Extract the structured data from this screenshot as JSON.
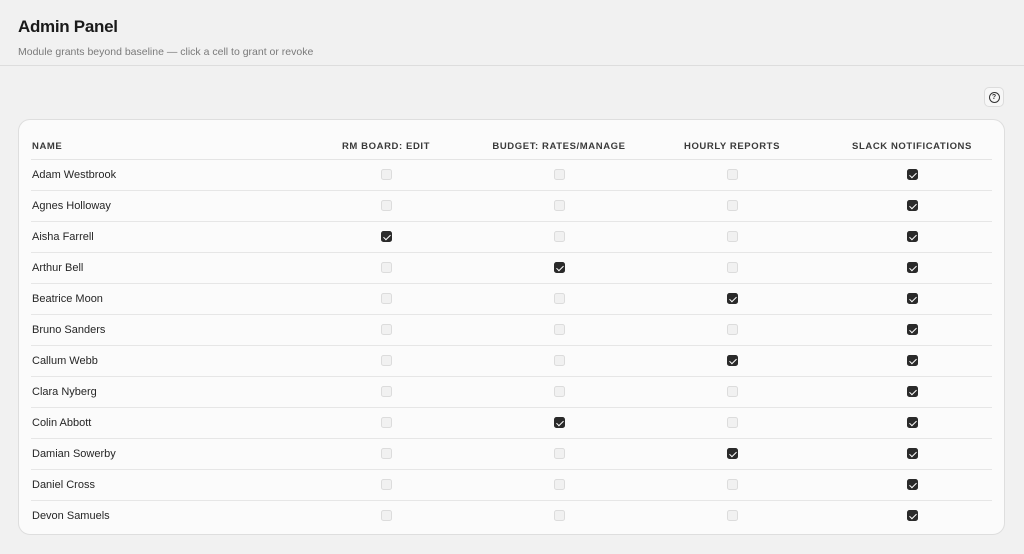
{
  "header": {
    "title": "Admin Panel",
    "subtitle": "Module grants beyond baseline — click a cell to grant or revoke"
  },
  "help": {
    "icon": "help-circle-icon",
    "glyph": "?"
  },
  "table": {
    "columns": [
      "NAME",
      "RM BOARD: EDIT",
      "BUDGET: RATES/MANAGE",
      "HOURLY REPORTS",
      "SLACK NOTIFICATIONS"
    ],
    "rows": [
      {
        "name": "Adam Westbrook",
        "grants": [
          false,
          false,
          false,
          true
        ]
      },
      {
        "name": "Agnes Holloway",
        "grants": [
          false,
          false,
          false,
          true
        ]
      },
      {
        "name": "Aisha Farrell",
        "grants": [
          true,
          false,
          false,
          true
        ]
      },
      {
        "name": "Arthur Bell",
        "grants": [
          false,
          true,
          false,
          true
        ]
      },
      {
        "name": "Beatrice Moon",
        "grants": [
          false,
          false,
          true,
          true
        ]
      },
      {
        "name": "Bruno Sanders",
        "grants": [
          false,
          false,
          false,
          true
        ]
      },
      {
        "name": "Callum Webb",
        "grants": [
          false,
          false,
          true,
          true
        ]
      },
      {
        "name": "Clara Nyberg",
        "grants": [
          false,
          false,
          false,
          true
        ]
      },
      {
        "name": "Colin Abbott",
        "grants": [
          false,
          true,
          false,
          true
        ]
      },
      {
        "name": "Damian Sowerby",
        "grants": [
          false,
          false,
          true,
          true
        ]
      },
      {
        "name": "Daniel Cross",
        "grants": [
          false,
          false,
          false,
          true
        ]
      },
      {
        "name": "Devon Samuels",
        "grants": [
          false,
          false,
          false,
          true
        ]
      }
    ]
  },
  "colors": {
    "background": "#f1f1f1",
    "checked": "#2a2a2a",
    "card": "#fbfbfb"
  }
}
